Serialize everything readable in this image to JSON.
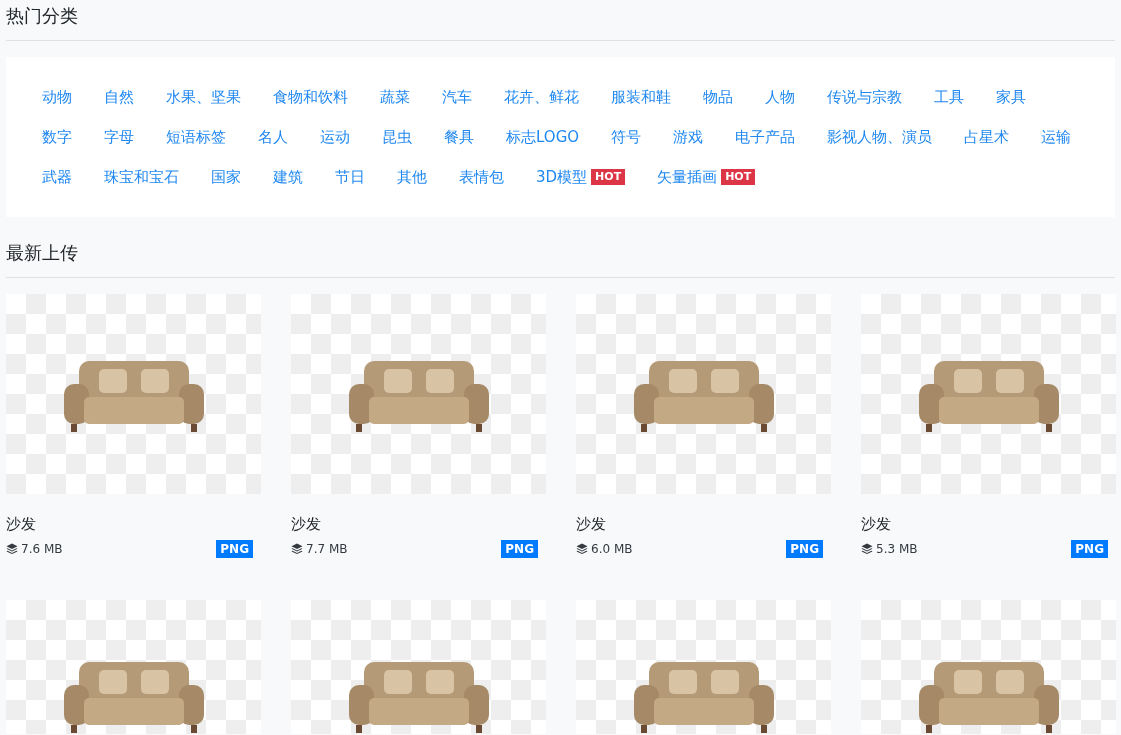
{
  "hot_categories": {
    "title": "热门分类",
    "tags": [
      {
        "label": "动物"
      },
      {
        "label": "自然"
      },
      {
        "label": "水果、坚果"
      },
      {
        "label": "食物和饮料"
      },
      {
        "label": "蔬菜"
      },
      {
        "label": "汽车"
      },
      {
        "label": "花卉、鲜花"
      },
      {
        "label": "服装和鞋"
      },
      {
        "label": "物品"
      },
      {
        "label": "人物"
      },
      {
        "label": "传说与宗教"
      },
      {
        "label": "工具"
      },
      {
        "label": "家具"
      },
      {
        "label": "数字"
      },
      {
        "label": "字母"
      },
      {
        "label": "短语标签"
      },
      {
        "label": "名人"
      },
      {
        "label": "运动"
      },
      {
        "label": "昆虫"
      },
      {
        "label": "餐具"
      },
      {
        "label": "标志LOGO"
      },
      {
        "label": "符号"
      },
      {
        "label": "游戏"
      },
      {
        "label": "电子产品"
      },
      {
        "label": "影视人物、演员"
      },
      {
        "label": "占星术"
      },
      {
        "label": "运输"
      },
      {
        "label": "武器"
      },
      {
        "label": "珠宝和宝石"
      },
      {
        "label": "国家"
      },
      {
        "label": "建筑"
      },
      {
        "label": "节日"
      },
      {
        "label": "其他"
      },
      {
        "label": "表情包"
      },
      {
        "label": "3D模型",
        "badge": "HOT"
      },
      {
        "label": "矢量插画",
        "badge": "HOT"
      }
    ]
  },
  "latest_uploads": {
    "title": "最新上传",
    "cards": [
      {
        "kind": "full",
        "title": "沙发",
        "size": "7.6 MB",
        "format": "PNG"
      },
      {
        "kind": "full",
        "title": "沙发",
        "size": "7.7 MB",
        "format": "PNG"
      },
      {
        "kind": "full",
        "title": "沙发",
        "size": "6.0 MB",
        "format": "PNG"
      },
      {
        "kind": "full",
        "title": "沙发",
        "size": "5.3 MB",
        "format": "PNG"
      },
      {
        "kind": "image"
      },
      {
        "kind": "image"
      },
      {
        "kind": "image"
      },
      {
        "kind": "image"
      }
    ]
  }
}
